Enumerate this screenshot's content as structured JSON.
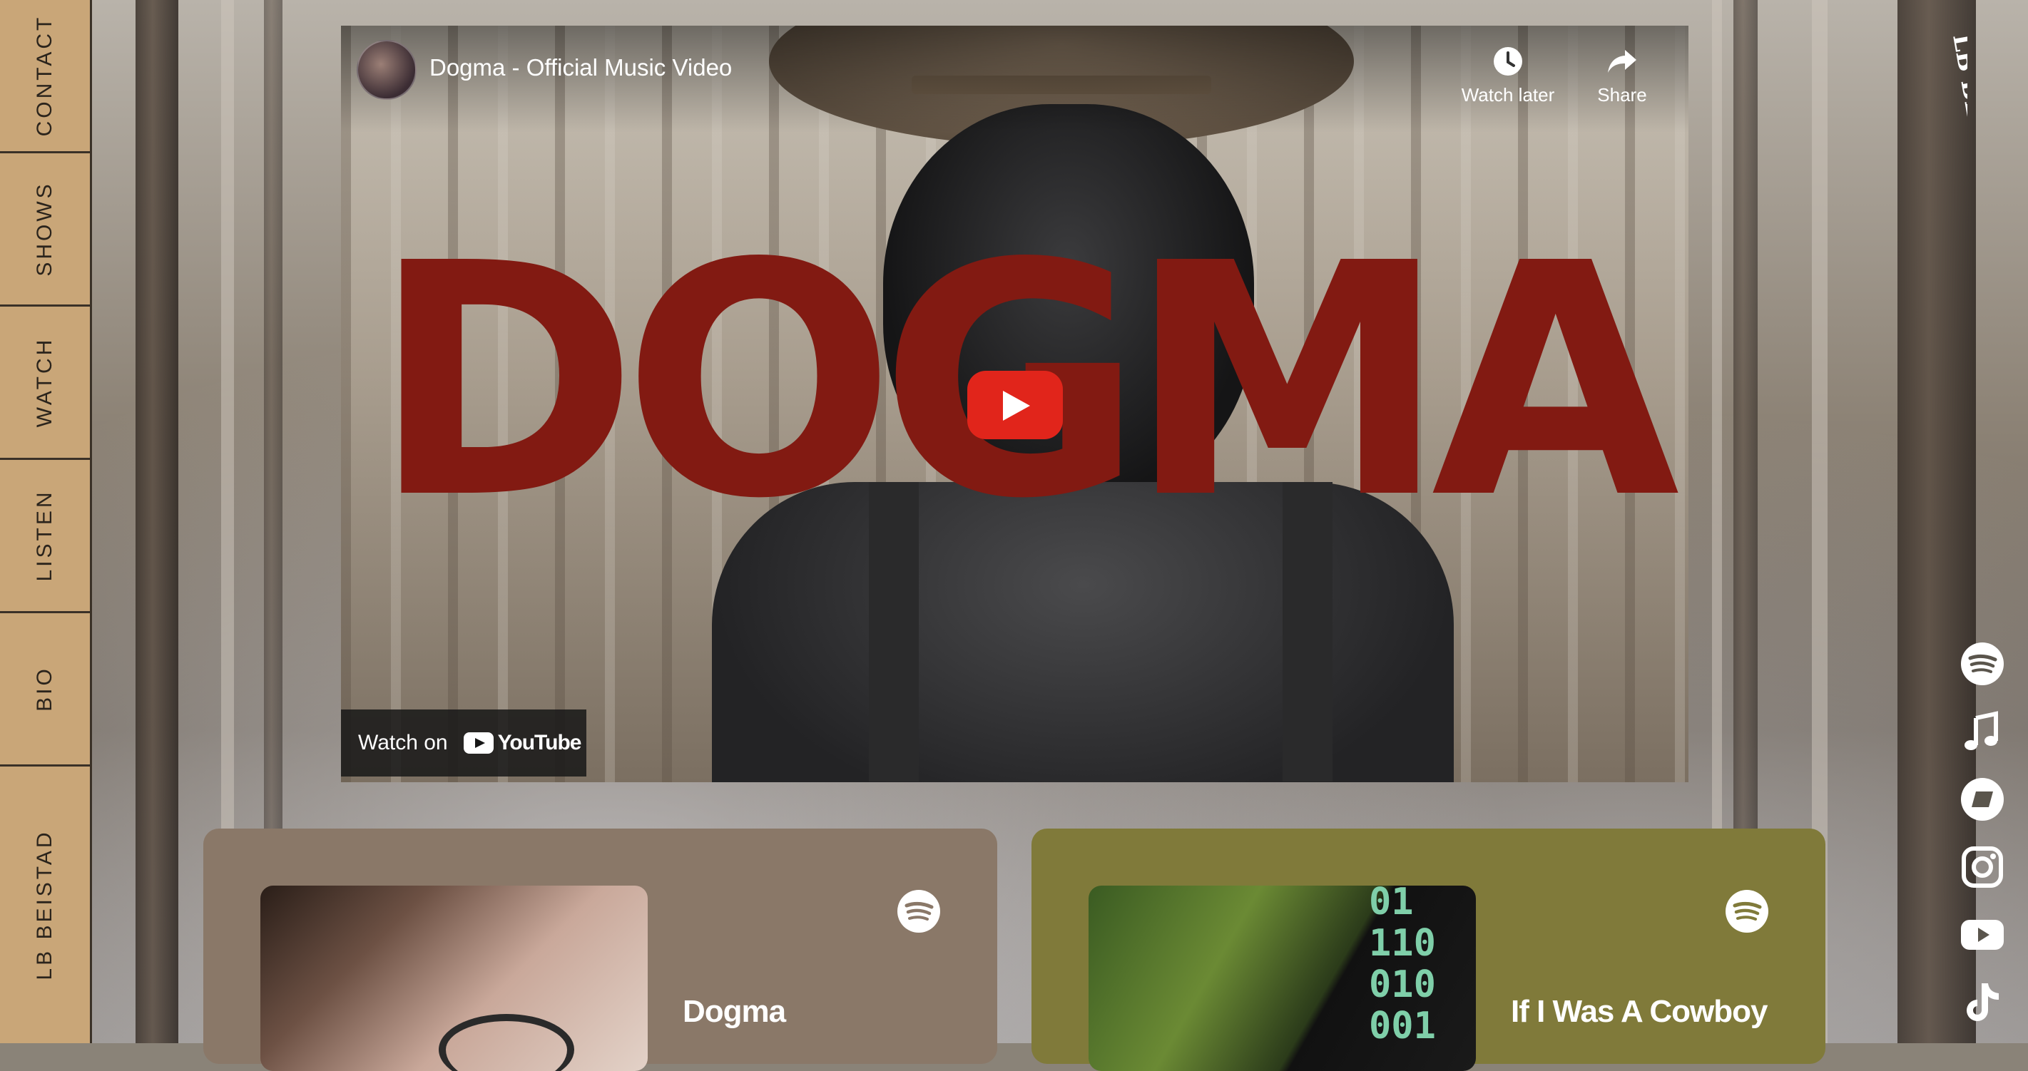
{
  "nav": {
    "items": [
      {
        "label": "CONTACT"
      },
      {
        "label": "SHOWS"
      },
      {
        "label": "WATCH"
      },
      {
        "label": "LISTEN"
      },
      {
        "label": "BIO"
      }
    ],
    "brand": "LB BEISTAD"
  },
  "logo_text": "LB BEISTAD",
  "video": {
    "title": "Dogma - Official Music Video",
    "overlay_text": "DOGMA",
    "watch_later_label": "Watch later",
    "share_label": "Share",
    "watch_on_label": "Watch on",
    "youtube_label": "YouTube"
  },
  "social": [
    "spotify-icon",
    "apple-music-icon",
    "bandcamp-icon",
    "instagram-icon",
    "youtube-icon",
    "tiktok-icon"
  ],
  "cards": [
    {
      "title": "Dogma",
      "service_icon": "spotify-icon",
      "color": "#8a7868"
    },
    {
      "title": "If I Was A Cowboy",
      "service_icon": "spotify-icon",
      "color": "#807a3a"
    }
  ],
  "colors": {
    "nav_bg": "#c9a678",
    "title_red": "#821a12",
    "play_red": "#e1251b"
  }
}
